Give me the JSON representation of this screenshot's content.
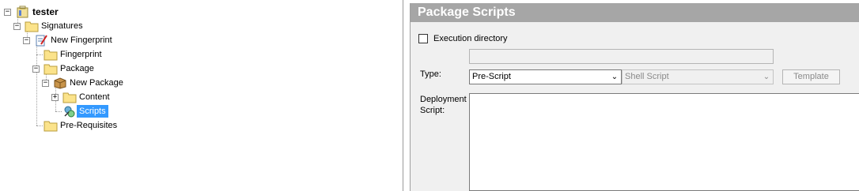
{
  "tree": {
    "nodes": [
      {
        "label": "tester",
        "icon": "briefcase-icon"
      },
      {
        "label": "Signatures",
        "icon": "folder-icon"
      },
      {
        "label": "New Fingerprint",
        "icon": "fingerprint-document-icon"
      },
      {
        "label": "Fingerprint",
        "icon": "folder-icon"
      },
      {
        "label": "Package",
        "icon": "folder-icon"
      },
      {
        "label": "New Package",
        "icon": "package-box-icon"
      },
      {
        "label": "Content",
        "icon": "folder-icon"
      },
      {
        "label": "Scripts",
        "icon": "scripts-icon",
        "selected": true
      },
      {
        "label": "Pre-Requisites",
        "icon": "folder-icon"
      }
    ]
  },
  "panel": {
    "title": "Package Scripts",
    "execution_directory_label": "Execution directory",
    "execution_directory_checked": false,
    "execution_directory_value": "",
    "type_label": "Type:",
    "type_value": "Pre-Script",
    "script_type_value": "Shell Script",
    "template_button": "Template",
    "deployment_label_line1": "Deployment",
    "deployment_label_line2": "Script:",
    "deployment_script": ""
  },
  "colors": {
    "header_bg": "#a6a6a6",
    "selection": "#3399ff",
    "panel_bg": "#f0f0f0"
  }
}
